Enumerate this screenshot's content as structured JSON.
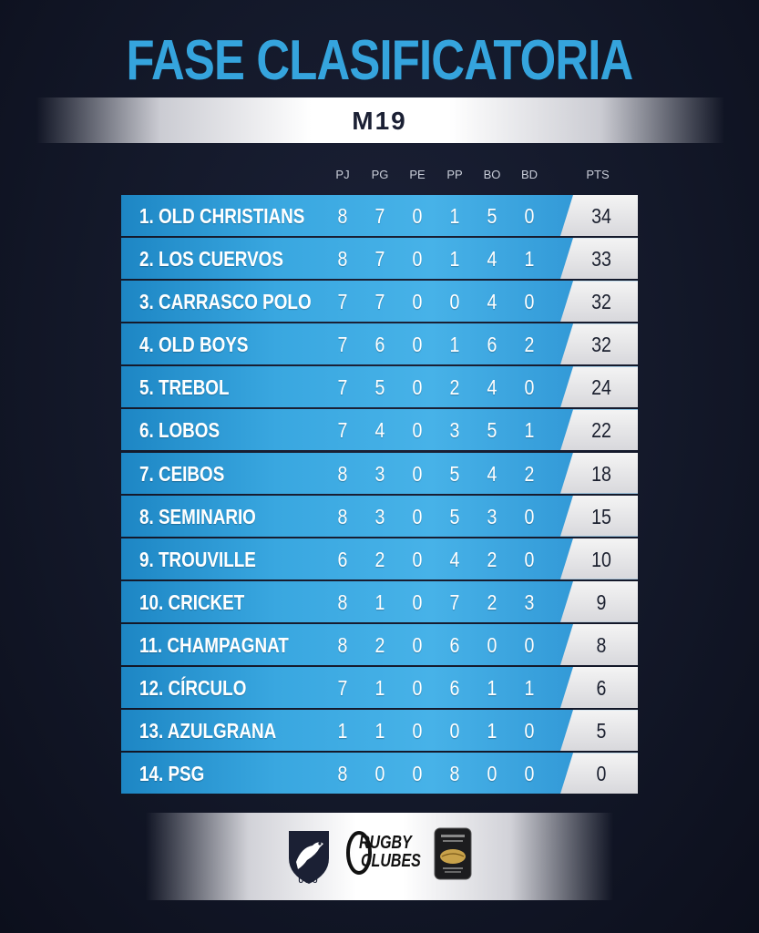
{
  "header": {
    "title": "FASE CLASIFICATORIA",
    "subtitle": "M19"
  },
  "columns": [
    "PJ",
    "PG",
    "PE",
    "PP",
    "BO",
    "BD",
    "PTS"
  ],
  "standings": [
    {
      "team": "1. OLD CHRISTIANS",
      "pj": "8",
      "pg": "7",
      "pe": "0",
      "pp": "1",
      "bo": "5",
      "bd": "0",
      "pts": "34"
    },
    {
      "team": "2. LOS CUERVOS",
      "pj": "8",
      "pg": "7",
      "pe": "0",
      "pp": "1",
      "bo": "4",
      "bd": "1",
      "pts": "33"
    },
    {
      "team": "3. CARRASCO POLO",
      "pj": "7",
      "pg": "7",
      "pe": "0",
      "pp": "0",
      "bo": "4",
      "bd": "0",
      "pts": "32"
    },
    {
      "team": "4. OLD BOYS",
      "pj": "7",
      "pg": "6",
      "pe": "0",
      "pp": "1",
      "bo": "6",
      "bd": "2",
      "pts": "32"
    },
    {
      "team": "5. TREBOL",
      "pj": "7",
      "pg": "5",
      "pe": "0",
      "pp": "2",
      "bo": "4",
      "bd": "0",
      "pts": "24"
    },
    {
      "team": "6. LOBOS",
      "pj": "7",
      "pg": "4",
      "pe": "0",
      "pp": "3",
      "bo": "5",
      "bd": "1",
      "pts": "22"
    },
    {
      "team": "7. CEIBOS",
      "pj": "8",
      "pg": "3",
      "pe": "0",
      "pp": "5",
      "bo": "4",
      "bd": "2",
      "pts": "18"
    },
    {
      "team": "8. SEMINARIO",
      "pj": "8",
      "pg": "3",
      "pe": "0",
      "pp": "5",
      "bo": "3",
      "bd": "0",
      "pts": "15"
    },
    {
      "team": "9. TROUVILLE",
      "pj": "6",
      "pg": "2",
      "pe": "0",
      "pp": "4",
      "bo": "2",
      "bd": "0",
      "pts": "10"
    },
    {
      "team": "10. CRICKET",
      "pj": "8",
      "pg": "1",
      "pe": "0",
      "pp": "7",
      "bo": "2",
      "bd": "3",
      "pts": "9"
    },
    {
      "team": "11. CHAMPAGNAT",
      "pj": "8",
      "pg": "2",
      "pe": "0",
      "pp": "6",
      "bo": "0",
      "bd": "0",
      "pts": "8"
    },
    {
      "team": "12. CÍRCULO",
      "pj": "7",
      "pg": "1",
      "pe": "0",
      "pp": "6",
      "bo": "1",
      "bd": "1",
      "pts": "6"
    },
    {
      "team": "13. AZULGRANA",
      "pj": "1",
      "pg": "1",
      "pe": "0",
      "pp": "0",
      "bo": "1",
      "bd": "0",
      "pts": "5"
    },
    {
      "team": "14. PSG",
      "pj": "8",
      "pg": "0",
      "pe": "0",
      "pp": "8",
      "bo": "0",
      "bd": "0",
      "pts": "0"
    }
  ],
  "footer": {
    "logos": [
      {
        "icon": "uru-bird-shield-icon",
        "label": "URU"
      },
      {
        "icon": "rugby-clubes-logo",
        "label_line1": "RUGBY",
        "label_line2": "CLUBES"
      },
      {
        "icon": "championship-badge-icon"
      }
    ]
  },
  "colors": {
    "background": "#131829",
    "title": "#35a4dd",
    "row": "#39a7e0",
    "points_box": "#e6e6ea",
    "points_text": "#1a1f2e"
  }
}
